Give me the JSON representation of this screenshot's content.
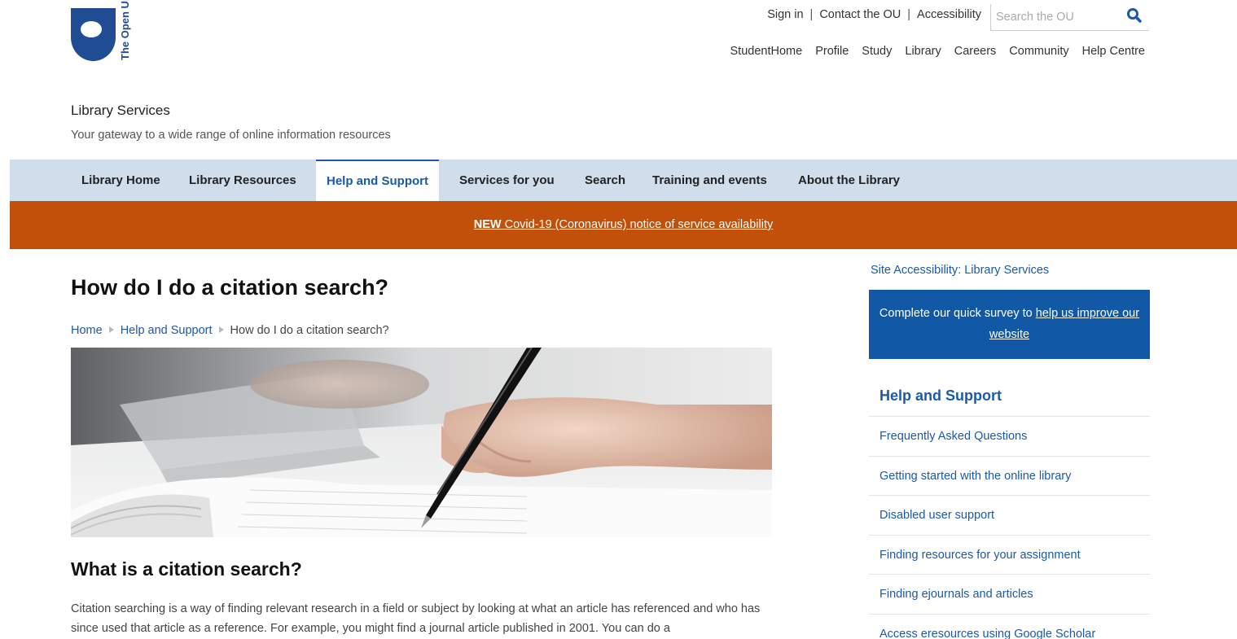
{
  "header": {
    "logo_text": "The Open University",
    "top_links": [
      "Sign in",
      "Contact the OU",
      "Accessibility"
    ],
    "search": {
      "placeholder": "Search the OU"
    },
    "main_nav": [
      "StudentHome",
      "Profile",
      "Study",
      "Library",
      "Careers",
      "Community",
      "Help Centre"
    ]
  },
  "service": {
    "title": "Library Services",
    "subtitle": "Your gateway to a wide range of online information resources"
  },
  "nav": {
    "tabs": [
      {
        "label": "Library Home",
        "active": false
      },
      {
        "label": "Library Resources",
        "active": false
      },
      {
        "label": "Help and Support",
        "active": true
      },
      {
        "label": "Services for you",
        "active": false
      },
      {
        "label": "Search",
        "active": false
      },
      {
        "label": "Training and events",
        "active": false
      },
      {
        "label": "About the Library",
        "active": false
      }
    ]
  },
  "banner": {
    "prefix": "NEW",
    "text": " Covid-19 (Coronavirus) notice of service availability",
    "color": "#c2500a"
  },
  "main": {
    "title": "How do I do a citation search?",
    "breadcrumb": [
      "Home",
      "Help and Support",
      "How do I do a citation search?"
    ],
    "section_heading": "What is a citation search?",
    "paragraph": "Citation searching is a way of finding relevant research in a field or subject by looking at what an article has referenced and who has since used that article as a reference. For example, you might find a journal article published in 2001. You can do a"
  },
  "sidebar": {
    "access_link": "Site Accessibility: Library Services",
    "survey": {
      "text": "Complete our quick survey to ",
      "link": "help us improve our website"
    },
    "heading": "Help and Support",
    "items": [
      "Frequently Asked Questions",
      "Getting started with the online library",
      "Disabled user support",
      "Finding resources for your assignment",
      "Finding ejournals and articles",
      "Access eresources using Google Scholar"
    ]
  },
  "colors": {
    "brand_blue": "#1f4c93",
    "link_blue": "#1a5aa6",
    "nav_bg": "#cfdeea",
    "survey_bg": "#1158a6"
  }
}
